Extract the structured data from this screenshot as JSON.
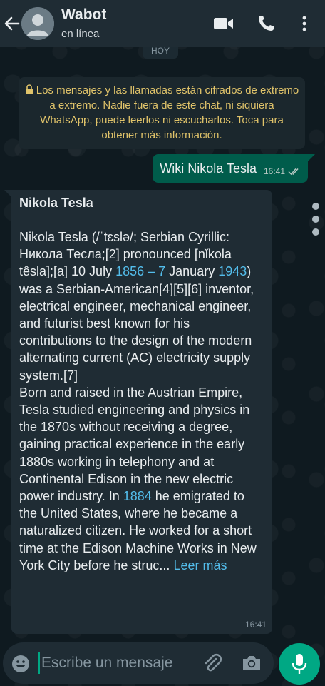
{
  "header": {
    "contact_name": "Wabot",
    "status": "en línea"
  },
  "date_chip": "HOY",
  "encryption_notice": "Los mensajes y las llamadas están cifrados de extremo a extremo. Nadie fuera de este chat, ni siquiera WhatsApp, puede leerlos ni escucharlos. Toca para obtener más información.",
  "messages": [
    {
      "direction": "outgoing",
      "text": "Wiki Nikola Tesla",
      "time": "16:41",
      "status": "read"
    },
    {
      "direction": "incoming",
      "title": "Nikola Tesla",
      "body_parts": [
        " Nikola Tesla (/ˈtɛslə/; Serbian Cyrillic: Никола Тесла;[2] pronounced [nǐkola têsla];[a] 10 July ",
        "1856 – 7",
        " January ",
        "1943",
        ") was a Serbian-American[4][5][6] inventor, electrical engineer, mechanical engineer, and futurist best known for his contributions to the design of the modern alternating current (AC) electricity supply system.[7]",
        "Born and raised in the Austrian Empire, Tesla studied engineering and physics in the 1870s without receiving a degree, gaining practical experience in the early 1880s working in telephony and at Continental Edison in the new electric power industry. In ",
        "1884",
        " he emigrated to the United States, where he became a naturalized citizen. He worked for a short time at the Edison Machine Works in New York City before he struc... ",
        "Leer más"
      ],
      "time": "16:41"
    }
  ],
  "input": {
    "placeholder": "Escribe un mensaje"
  },
  "icons": {
    "back": "back-arrow-icon",
    "video": "video-call-icon",
    "call": "phone-icon",
    "menu": "more-vert-icon",
    "emoji": "emoji-icon",
    "attach": "paperclip-icon",
    "camera": "camera-icon",
    "mic": "microphone-icon"
  },
  "colors": {
    "header_bg": "#1f2c34",
    "outgoing_bubble": "#005c4b",
    "incoming_bubble": "#1f2c34",
    "link": "#53bdeb",
    "accent": "#00a884",
    "notice_text": "#e0c36a"
  }
}
